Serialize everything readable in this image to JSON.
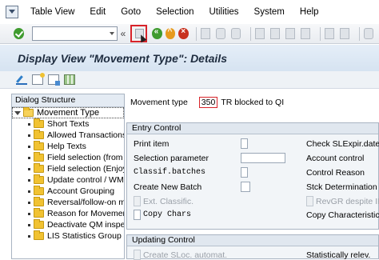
{
  "menu": {
    "items": [
      "Table View",
      "Edit",
      "Goto",
      "Selection",
      "Utilities",
      "System",
      "Help"
    ]
  },
  "toolbar": {
    "command_value": "",
    "back_glyph": "«"
  },
  "title": "Display View \"Movement Type\": Details",
  "dialog_structure": {
    "header": "Dialog Structure",
    "root": "Movement Type",
    "items": [
      "Short Texts",
      "Allowed Transactions",
      "Help Texts",
      "Field selection (from",
      "Field selection (Enjoy",
      "Update control / WM",
      "Account Grouping",
      "Reversal/follow-on m",
      "Reason for Movemen",
      "Deactivate QM inspe",
      "LIS Statistics Group"
    ]
  },
  "movement_type": {
    "label": "Movement type",
    "value": "350",
    "description": "TR blocked to QI"
  },
  "entry_control": {
    "header": "Entry Control",
    "left": [
      {
        "label": "Print item",
        "mono": false,
        "disabled": false
      },
      {
        "label": "Selection parameter",
        "mono": false,
        "disabled": false
      },
      {
        "label": "Classif.batches",
        "mono": true,
        "disabled": false
      },
      {
        "label": "Create New Batch",
        "mono": false,
        "disabled": false
      },
      {
        "label": "Ext. Classific.",
        "mono": false,
        "disabled": true
      },
      {
        "label": "Copy Chars",
        "mono": true,
        "disabled": false
      }
    ],
    "right": [
      {
        "label": "Check SLExpir.date",
        "disabled": false
      },
      {
        "label": "Account control",
        "disabled": false
      },
      {
        "label": "Control Reason",
        "disabled": false
      },
      {
        "label": "Stck Determination Rul",
        "disabled": false
      },
      {
        "label": "RevGR despite IR",
        "disabled": true
      },
      {
        "label": "Copy Characteristics",
        "disabled": false
      }
    ]
  },
  "updating_control": {
    "header": "Updating Control",
    "left_label": "Create SLoc. automat.",
    "right_label": "Statistically relev."
  },
  "colors": {
    "highlight_border": "#d8232a",
    "folder": "#f1c232",
    "title_bg": "#dbe6f2"
  }
}
